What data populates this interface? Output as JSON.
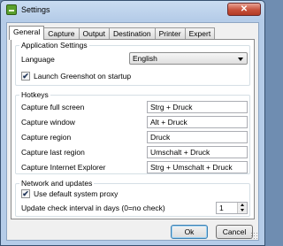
{
  "window": {
    "title": "Settings",
    "close_glyph": "✕"
  },
  "tabs": [
    "General",
    "Capture",
    "Output",
    "Destination",
    "Printer",
    "Expert"
  ],
  "active_tab": "General",
  "app_settings": {
    "legend": "Application Settings",
    "language_label": "Language",
    "language_value": "English",
    "launch_label": "Launch Greenshot on startup",
    "launch_checked": true
  },
  "hotkeys": {
    "legend": "Hotkeys",
    "rows": [
      {
        "label": "Capture full screen",
        "value": "Strg + Druck"
      },
      {
        "label": "Capture window",
        "value": "Alt + Druck"
      },
      {
        "label": "Capture region",
        "value": "Druck"
      },
      {
        "label": "Capture last region",
        "value": "Umschalt + Druck"
      },
      {
        "label": "Capture Internet Explorer",
        "value": "Strg + Umschalt + Druck"
      }
    ]
  },
  "network": {
    "legend": "Network and updates",
    "proxy_label": "Use default system proxy",
    "proxy_checked": true,
    "update_label": "Update check interval in days (0=no check)",
    "update_value": "1"
  },
  "buttons": {
    "ok": "Ok",
    "cancel": "Cancel"
  },
  "icons": {
    "app": "greenshot-icon",
    "check": "✔"
  }
}
